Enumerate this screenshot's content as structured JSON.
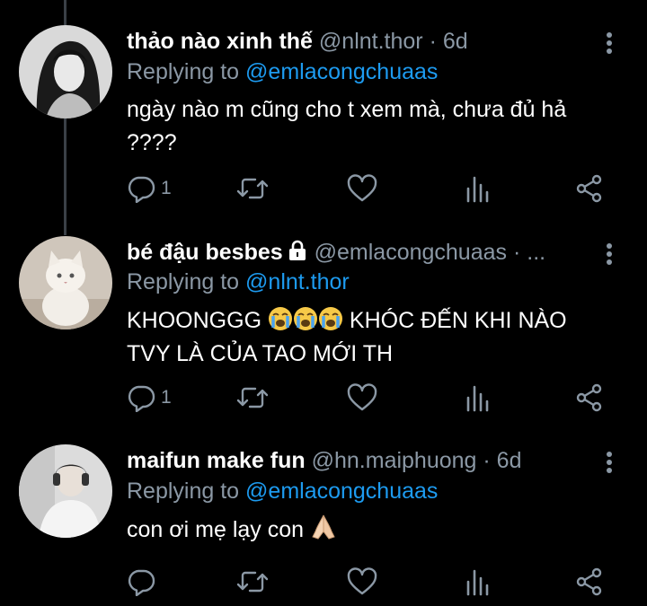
{
  "colors": {
    "background": "#000000",
    "text": "#ffffff",
    "secondary": "#8b98a5",
    "accent": "#1d9bf0",
    "thread_line": "#3a4047"
  },
  "replies": [
    {
      "display_name": "thảo nào xinh thế",
      "handle": "@nlnt.thor",
      "time": " · 6d",
      "replying_to_label": "Replying to",
      "replying_to": "@emlacongchuaas",
      "text": "ngày nào m cũng cho t xem mà, chưa đủ hả ????",
      "reply_count": "1",
      "icons": [
        "reply-icon",
        "retweet-icon",
        "like-icon",
        "analytics-icon",
        "share-icon",
        "more-icon"
      ]
    },
    {
      "display_name": "bé đậu besbes",
      "handle": "@emlacongchuaas",
      "time": " · ...",
      "protected": true,
      "replying_to_label": "Replying to",
      "replying_to": "@nlnt.thor",
      "text_a": "KHOONGGG",
      "text_b": "KHÓC ĐẾN KHI NÀO TVY LÀ CỦA TAO MỚI TH",
      "emoji": "loudly-crying-face",
      "reply_count": "1",
      "icons": [
        "reply-icon",
        "retweet-icon",
        "like-icon",
        "analytics-icon",
        "share-icon",
        "more-icon",
        "lock-icon"
      ]
    },
    {
      "display_name": "maifun make fun",
      "handle": "@hn.maiphuong",
      "time": " · 6d",
      "replying_to_label": "Replying to",
      "replying_to": "@emlacongchuaas",
      "text": "con ơi mẹ lạy con",
      "emoji": "folded-hands",
      "reply_count": "",
      "icons": [
        "reply-icon",
        "retweet-icon",
        "like-icon",
        "analytics-icon",
        "share-icon",
        "more-icon"
      ]
    }
  ]
}
